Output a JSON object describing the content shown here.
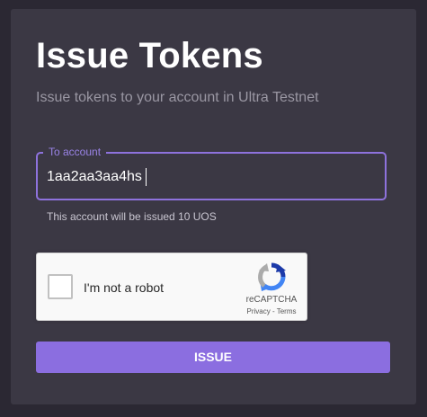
{
  "page": {
    "title": "Issue Tokens",
    "subtitle": "Issue tokens to your account in Ultra Testnet"
  },
  "form": {
    "account_field": {
      "label": "To account",
      "value": "1aa2aa3aa4hs"
    },
    "helper_text": "This account will be issued 10 UOS",
    "captcha": {
      "checkbox_label": "I'm not a robot",
      "brand": "reCAPTCHA",
      "privacy_link": "Privacy",
      "separator": " - ",
      "terms_link": "Terms",
      "checked": false
    },
    "submit_label": "ISSUE"
  },
  "colors": {
    "page_background": "#2b2833",
    "card_background": "#3b3844",
    "accent": "#8b6ee0",
    "field_border": "#8e72dd",
    "subtitle_text": "#9a97a3"
  },
  "icons": {
    "captcha_logo": "recaptcha-logo-icon"
  }
}
